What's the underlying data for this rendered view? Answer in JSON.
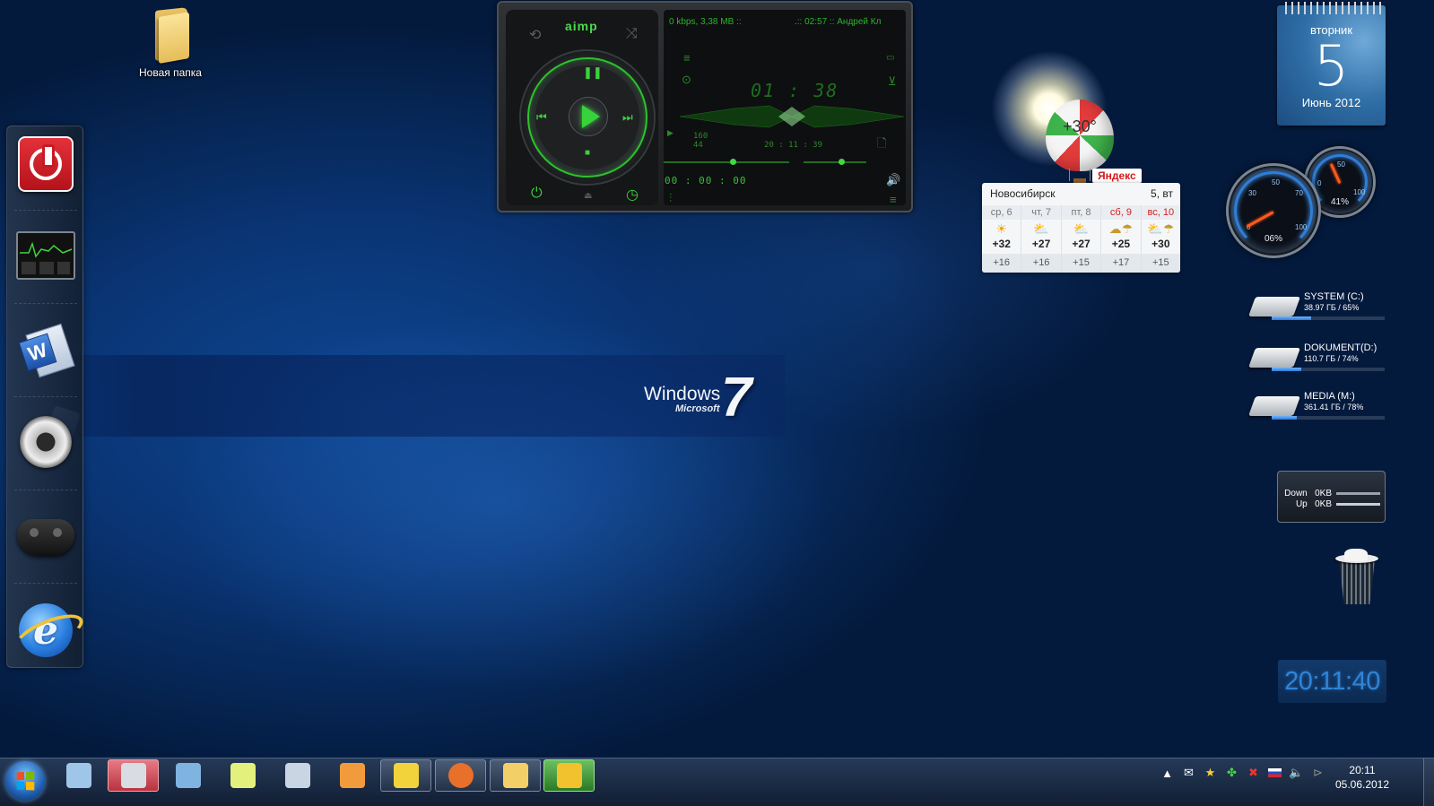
{
  "desktop": {
    "folder_label": "Новая папка"
  },
  "aimp": {
    "logo": "aimp",
    "bitrate_info": "0 kbps, 3,38 MB ::",
    "track_info": ".:: 02:57 :: Андрей Кл",
    "time_display": "01 : 38",
    "small_left_top": "160",
    "small_left_bottom": "44",
    "clock_small": "20 : 11 : 39",
    "position": "00 : 00 : 00",
    "progress_fraction": 0.55,
    "volume_fraction": 0.6,
    "accent_color": "#3cd03c"
  },
  "weather": {
    "balloon_temp": "+30°",
    "provider": "Яндекс",
    "city": "Новосибирск",
    "today": "5, вт",
    "days": [
      {
        "name": "ср, 6",
        "icon": "sun-icon",
        "glyph": "☀",
        "hi": "+32",
        "lo": "+16",
        "weekend": false
      },
      {
        "name": "чт, 7",
        "icon": "partly-cloudy-icon",
        "glyph": "⛅",
        "hi": "+27",
        "lo": "+16",
        "weekend": false
      },
      {
        "name": "пт, 8",
        "icon": "partly-cloudy-icon",
        "glyph": "⛅",
        "hi": "+27",
        "lo": "+15",
        "weekend": false
      },
      {
        "name": "сб, 9",
        "icon": "storm-rain-icon",
        "glyph": "☁☂",
        "hi": "+25",
        "lo": "+17",
        "weekend": true
      },
      {
        "name": "вс, 10",
        "icon": "cloud-rain-icon",
        "glyph": "⛅☂",
        "hi": "+30",
        "lo": "+15",
        "weekend": true
      }
    ]
  },
  "calendar": {
    "weekday": "вторник",
    "day": "5",
    "month_year": "Июнь 2012"
  },
  "gauges": {
    "cpu_percent": "06%",
    "ram_percent": "41%",
    "cpu_value": 6,
    "ram_value": 41,
    "ticks_big": [
      "0",
      "30",
      "50",
      "70",
      "100"
    ],
    "ticks_small": [
      "0",
      "50",
      "100"
    ]
  },
  "drives": [
    {
      "name": "SYSTEM (C:)",
      "meta": "38.97 ГБ / 65%",
      "fill": 0.35
    },
    {
      "name": "DOKUMENT(D:)",
      "meta": "110.7 ГБ / 74%",
      "fill": 0.26
    },
    {
      "name": "MEDIA (M:)",
      "meta": "361.41 ГБ / 78%",
      "fill": 0.22
    }
  ],
  "network": {
    "down_label": "Down",
    "down_value": "0KB",
    "up_label": "Up",
    "up_value": "0KB"
  },
  "digital_clock": "20:11:40",
  "windows_logo": {
    "word": "Windows",
    "maker": "Microsoft",
    "version": "7"
  },
  "taskbar": {
    "apps": [
      {
        "name": "calculator",
        "color": "#9fc5e8"
      },
      {
        "name": "snipping-tool",
        "color": "#d9dde3"
      },
      {
        "name": "photo-viewer",
        "color": "#7fb3e0"
      },
      {
        "name": "sticky-notes",
        "color": "#e3f07b"
      },
      {
        "name": "sync-center",
        "color": "#c9d5e2"
      },
      {
        "name": "paint",
        "color": "#f29b3c"
      },
      {
        "name": "game-app",
        "color": "#f2d33c"
      },
      {
        "name": "firefox",
        "color": "#e8702a"
      },
      {
        "name": "explorer",
        "color": "#f3cf68"
      },
      {
        "name": "aimp-taskbar",
        "color": "#f2c12e"
      }
    ],
    "clock_time": "20:11",
    "clock_date": "05.06.2012"
  }
}
